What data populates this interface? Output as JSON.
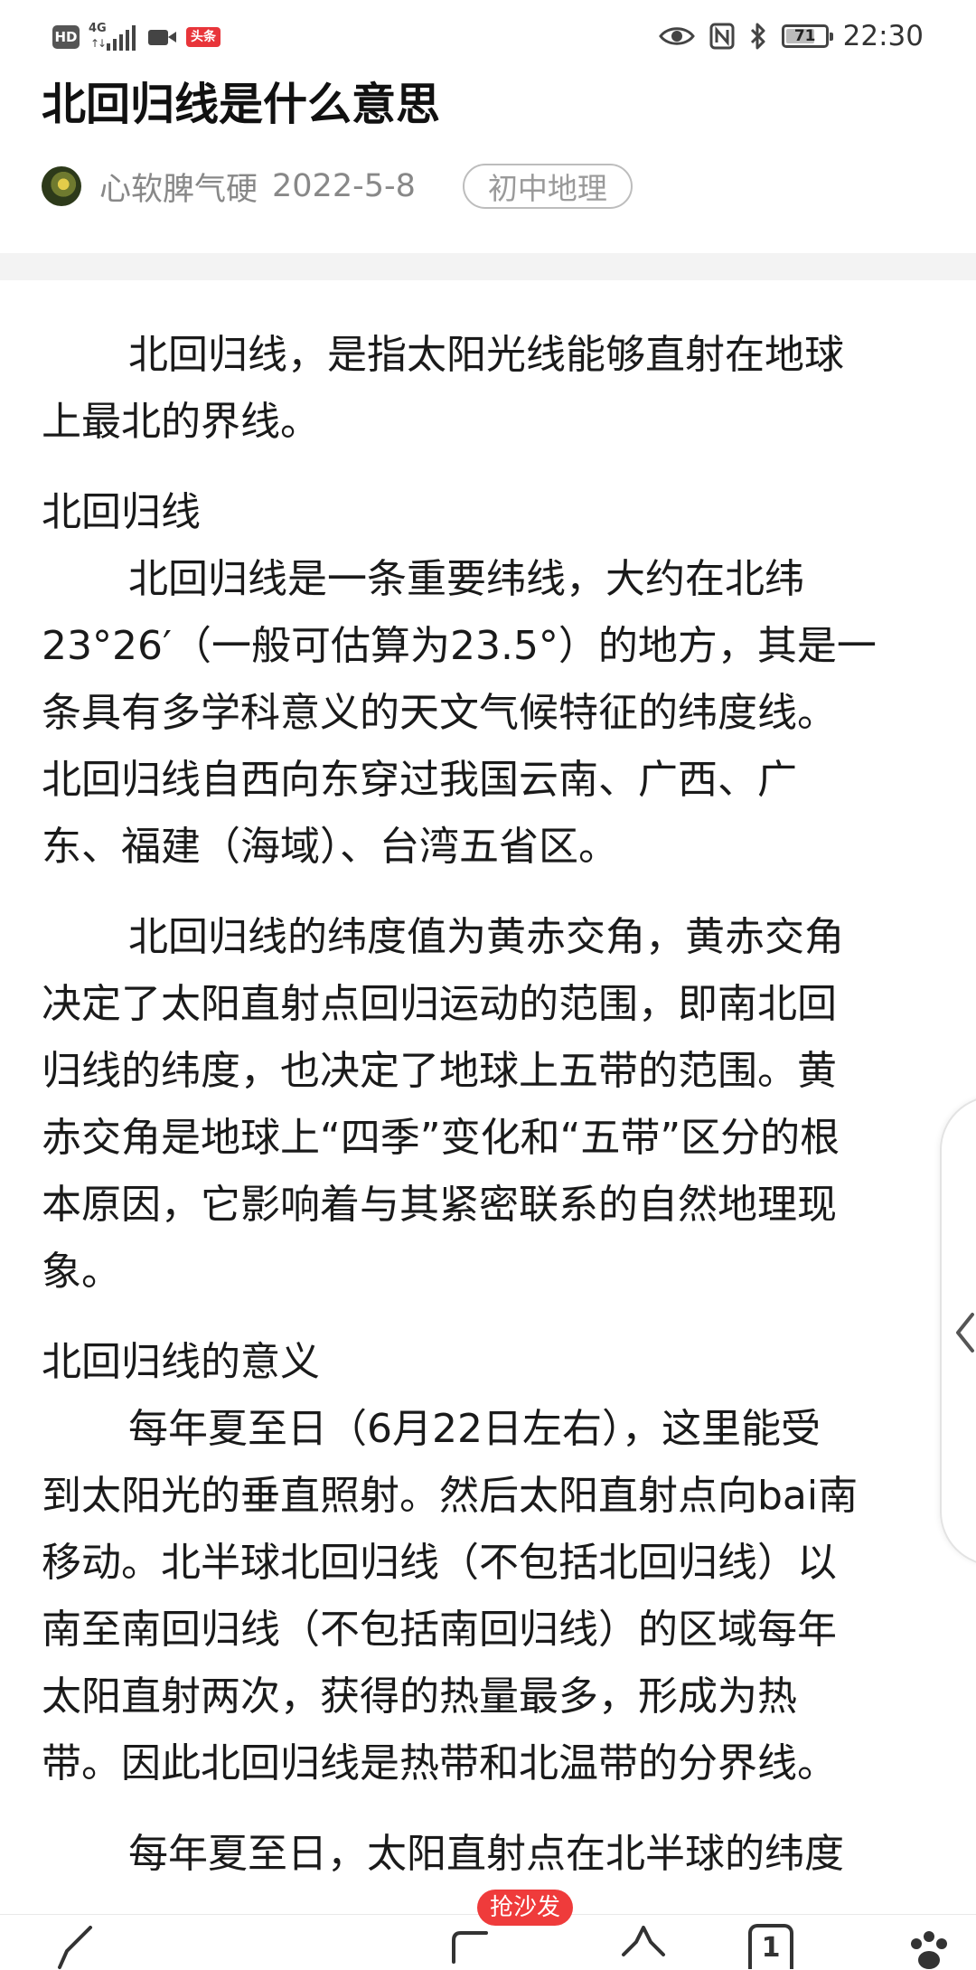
{
  "status_bar": {
    "hd": "HD",
    "network": "4G",
    "network_arrows": "↑↓",
    "news_badge": "头条",
    "nfc": "N",
    "battery": "71",
    "time": "22:30"
  },
  "article": {
    "title": "北回归线是什么意思",
    "author": "心软脾气硬",
    "date": "2022-5-8",
    "tag": "初中地理",
    "paragraphs": [
      {
        "indent": true,
        "lines": [
          "北回归线，是指太阳光线能够直射在地球",
          "上最北的界线。"
        ]
      },
      {
        "indent": false,
        "tight": true,
        "lines": [
          "北回归线"
        ]
      },
      {
        "indent": true,
        "lines": [
          "北回归线是一条重要纬线，大约在北纬",
          "23°26′（一般可估算为23.5°）的地方，其是一",
          "条具有多学科意义的天文气候特征的纬度线。",
          "北回归线自西向东穿过我国云南、广西、广",
          "东、福建（海域）、台湾五省区。"
        ]
      },
      {
        "indent": true,
        "lines": [
          "北回归线的纬度值为黄赤交角，黄赤交角",
          "决定了太阳直射点回归运动的范围，即南北回",
          "归线的纬度，也决定了地球上五带的范围。黄",
          "赤交角是地球上“四季”变化和“五带”区分的根",
          "本原因，它影响着与其紧密联系的自然地理现",
          "象。"
        ]
      },
      {
        "indent": false,
        "tight": true,
        "lines": [
          "北回归线的意义"
        ]
      },
      {
        "indent": true,
        "lines": [
          "每年夏至日（6月22日左右），这里能受",
          "到太阳光的垂直照射。然后太阳直射点向bai南",
          "移动。北半球北回归线（不包括北回归线）以",
          "南至南回归线（不包括南回归线）的区域每年",
          "太阳直射两次，获得的热量最多，形成为热",
          "带。因此北回归线是热带和北温带的分界线。"
        ]
      },
      {
        "indent": true,
        "lines": [
          "每年夏至日，太阳直射点在北半球的纬度"
        ]
      }
    ]
  },
  "bottom_bar": {
    "sofa_badge": "抢沙发",
    "comment_count": "1"
  },
  "colors": {
    "badge_red": "#ef3b3b",
    "meta_gray": "#888888",
    "divider": "#f3f3f3"
  }
}
